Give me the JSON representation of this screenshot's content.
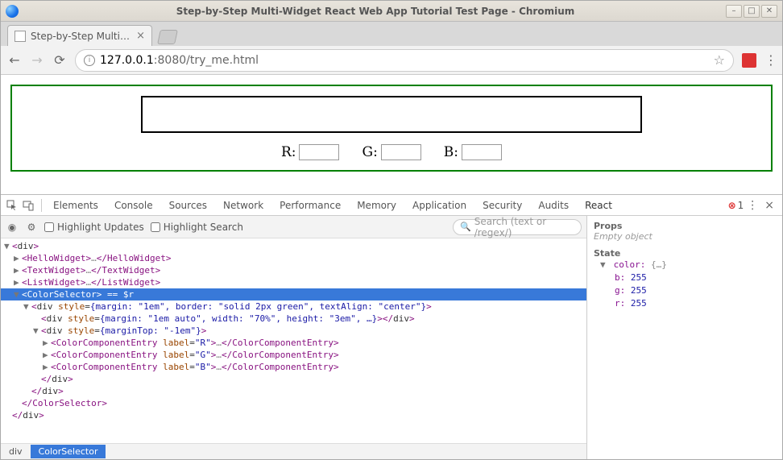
{
  "window": {
    "title": "Step-by-Step Multi-Widget React Web App Tutorial Test Page - Chromium"
  },
  "tab": {
    "title": "Step-by-Step Multi-W"
  },
  "omnibox": {
    "host": "127.0.0.1",
    "port": ":8080",
    "path": "/try_me.html"
  },
  "colorSelector": {
    "labels": {
      "r": "R:",
      "g": "G:",
      "b": "B:"
    },
    "values": {
      "r": "",
      "g": "",
      "b": ""
    }
  },
  "devtools": {
    "tabs": [
      "Elements",
      "Console",
      "Sources",
      "Network",
      "Performance",
      "Memory",
      "Application",
      "Security",
      "Audits",
      "React"
    ],
    "activeTab": "React",
    "errorCount": "1",
    "toolbar": {
      "highlightUpdates": "Highlight Updates",
      "highlightSearch": "Highlight Search",
      "searchPlaceholder": "Search (text or /regex/)"
    },
    "tree": {
      "l0": "<div>",
      "l1_open": "<HelloWidget>",
      "l1_close": "</HelloWidget>",
      "l2_open": "<TextWidget>",
      "l2_close": "</TextWidget>",
      "l3_open": "<ListWidget>",
      "l3_close": "</ListWidget>",
      "l4": "<ColorSelector> == $r",
      "l5_a": "<div ",
      "l5_attr": "style",
      "l5_v": "{margin: \"1em\", border: \"solid 2px green\", textAlign: \"center\"}",
      "l5_z": ">",
      "l6_a": "<div ",
      "l6_attr": "style",
      "l6_v": "{margin: \"1em auto\", width: \"70%\", height: \"3em\", …}",
      "l6_z": "></div>",
      "l7_a": "<div ",
      "l7_attr": "style",
      "l7_v": "{marginTop: \"-1em\"}",
      "l7_z": ">",
      "cce_open": "<ColorComponentEntry ",
      "cce_lbl": "label",
      "cce_r": "\"R\"",
      "cce_g": "\"G\"",
      "cce_b": "\"B\"",
      "cce_mid": ">…</ColorComponentEntry>",
      "close_div": "</div>",
      "close_cs": "</ColorSelector>"
    },
    "crumbs": {
      "div": "div",
      "cs": "ColorSelector"
    },
    "side": {
      "props": "Props",
      "emptyObject": "Empty object",
      "state": "State",
      "colorKey": "color:",
      "colorVal": "{…}",
      "b": {
        "k": "b:",
        "v": "255"
      },
      "g": {
        "k": "g:",
        "v": "255"
      },
      "r": {
        "k": "r:",
        "v": "255"
      }
    }
  }
}
